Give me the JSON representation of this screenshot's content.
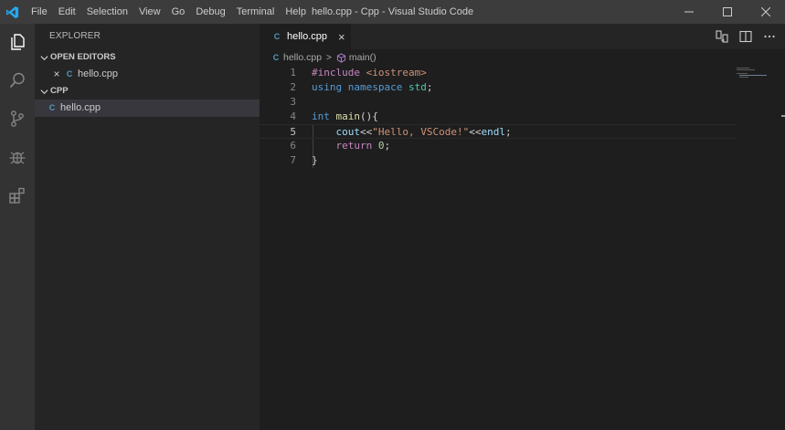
{
  "window": {
    "title": "hello.cpp - Cpp - Visual Studio Code"
  },
  "menu": [
    "File",
    "Edit",
    "Selection",
    "View",
    "Go",
    "Debug",
    "Terminal",
    "Help"
  ],
  "activity_bar": {
    "items": [
      {
        "name": "explorer",
        "icon": "files-icon",
        "active": true
      },
      {
        "name": "search",
        "icon": "search-icon",
        "active": false
      },
      {
        "name": "source-control",
        "icon": "source-control-icon",
        "active": false
      },
      {
        "name": "debug",
        "icon": "debug-icon",
        "active": false
      },
      {
        "name": "extensions",
        "icon": "extensions-icon",
        "active": false
      }
    ]
  },
  "sidebar": {
    "title": "EXPLORER",
    "open_editors": {
      "header": "OPEN EDITORS",
      "files": [
        {
          "close": "×",
          "badge": "C",
          "name": "hello.cpp"
        }
      ]
    },
    "folder": {
      "header": "CPP",
      "files": [
        {
          "badge": "C",
          "name": "hello.cpp",
          "selected": true
        }
      ]
    }
  },
  "editor": {
    "tab": {
      "badge": "C",
      "label": "hello.cpp",
      "close": "×"
    },
    "breadcrumb": {
      "file": "hello.cpp",
      "separator": ">",
      "symbol": "main()"
    },
    "current_line": 5,
    "lines": [
      {
        "number": "1",
        "tokens": [
          {
            "t": "#include ",
            "c": "pre"
          },
          {
            "t": "<iostream>",
            "c": "inc"
          }
        ]
      },
      {
        "number": "2",
        "tokens": [
          {
            "t": "using ",
            "c": "kw"
          },
          {
            "t": "namespace ",
            "c": "kw"
          },
          {
            "t": "std",
            "c": "ns"
          },
          {
            "t": ";",
            "c": "def"
          }
        ]
      },
      {
        "number": "3",
        "tokens": []
      },
      {
        "number": "4",
        "tokens": [
          {
            "t": "int ",
            "c": "kw"
          },
          {
            "t": "main",
            "c": "fn"
          },
          {
            "t": "(){",
            "c": "def"
          }
        ]
      },
      {
        "number": "5",
        "tokens": [
          {
            "t": "    ",
            "c": "def"
          },
          {
            "t": "cout",
            "c": "id"
          },
          {
            "t": "<<",
            "c": "def"
          },
          {
            "t": "\"Hello, VSCode!\"",
            "c": "str"
          },
          {
            "t": "<<",
            "c": "def"
          },
          {
            "t": "endl",
            "c": "id"
          },
          {
            "t": ";",
            "c": "def"
          }
        ]
      },
      {
        "number": "6",
        "tokens": [
          {
            "t": "    ",
            "c": "def"
          },
          {
            "t": "return ",
            "c": "ctl"
          },
          {
            "t": "0",
            "c": "num"
          },
          {
            "t": ";",
            "c": "def"
          }
        ]
      },
      {
        "number": "7",
        "tokens": [
          {
            "t": "}",
            "c": "def"
          }
        ]
      }
    ]
  },
  "colors": {
    "titlebar": "#3c3c3c",
    "activitybar": "#333333",
    "sidebar": "#252526",
    "editor": "#1e1e1e",
    "accent_logo": "#23a9f2"
  }
}
